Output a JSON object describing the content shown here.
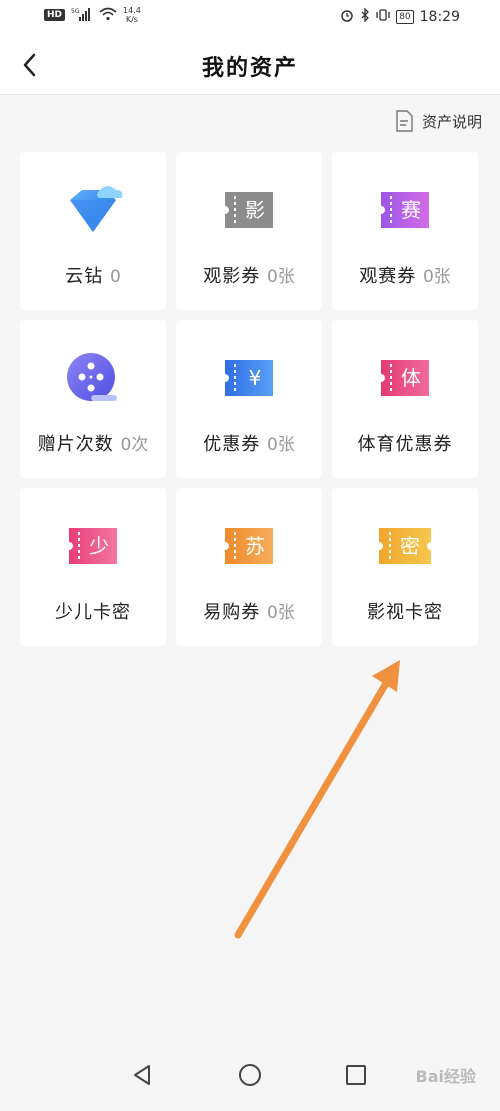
{
  "status": {
    "net_speed": "14.4",
    "net_unit": "K/s",
    "time": "18:29",
    "battery": "80",
    "signal": "5G"
  },
  "header": {
    "title": "我的资产"
  },
  "explain_link": "资产说明",
  "assets": [
    {
      "name": "云钻",
      "count": "0",
      "icon": "diamond-icon"
    },
    {
      "name": "观影券",
      "count": "0张",
      "icon": "movie-ticket-icon",
      "glyph": "影"
    },
    {
      "name": "观赛券",
      "count": "0张",
      "icon": "match-ticket-icon",
      "glyph": "赛"
    },
    {
      "name": "赠片次数",
      "count": "0次",
      "icon": "film-reel-icon"
    },
    {
      "name": "优惠券",
      "count": "0张",
      "icon": "coupon-icon",
      "glyph": "¥"
    },
    {
      "name": "体育优惠券",
      "count": "",
      "icon": "sports-coupon-icon",
      "glyph": "体"
    },
    {
      "name": "少儿卡密",
      "count": "",
      "icon": "kids-card-icon",
      "glyph": "少"
    },
    {
      "name": "易购券",
      "count": "0张",
      "icon": "suning-coupon-icon",
      "glyph": "苏"
    },
    {
      "name": "影视卡密",
      "count": "",
      "icon": "video-card-icon",
      "glyph": "密"
    }
  ],
  "watermark": "Bai经验",
  "colors": {
    "accent_arrow": "#f0913f",
    "gray_ticket": "#8c8c8c",
    "purple_ticket": "#b25ee6",
    "blue_ticket": "#3f7de8",
    "pink_ticket": "#e6477e",
    "orange_ticket": "#f09236",
    "gold_ticket": "#f0b63a"
  }
}
